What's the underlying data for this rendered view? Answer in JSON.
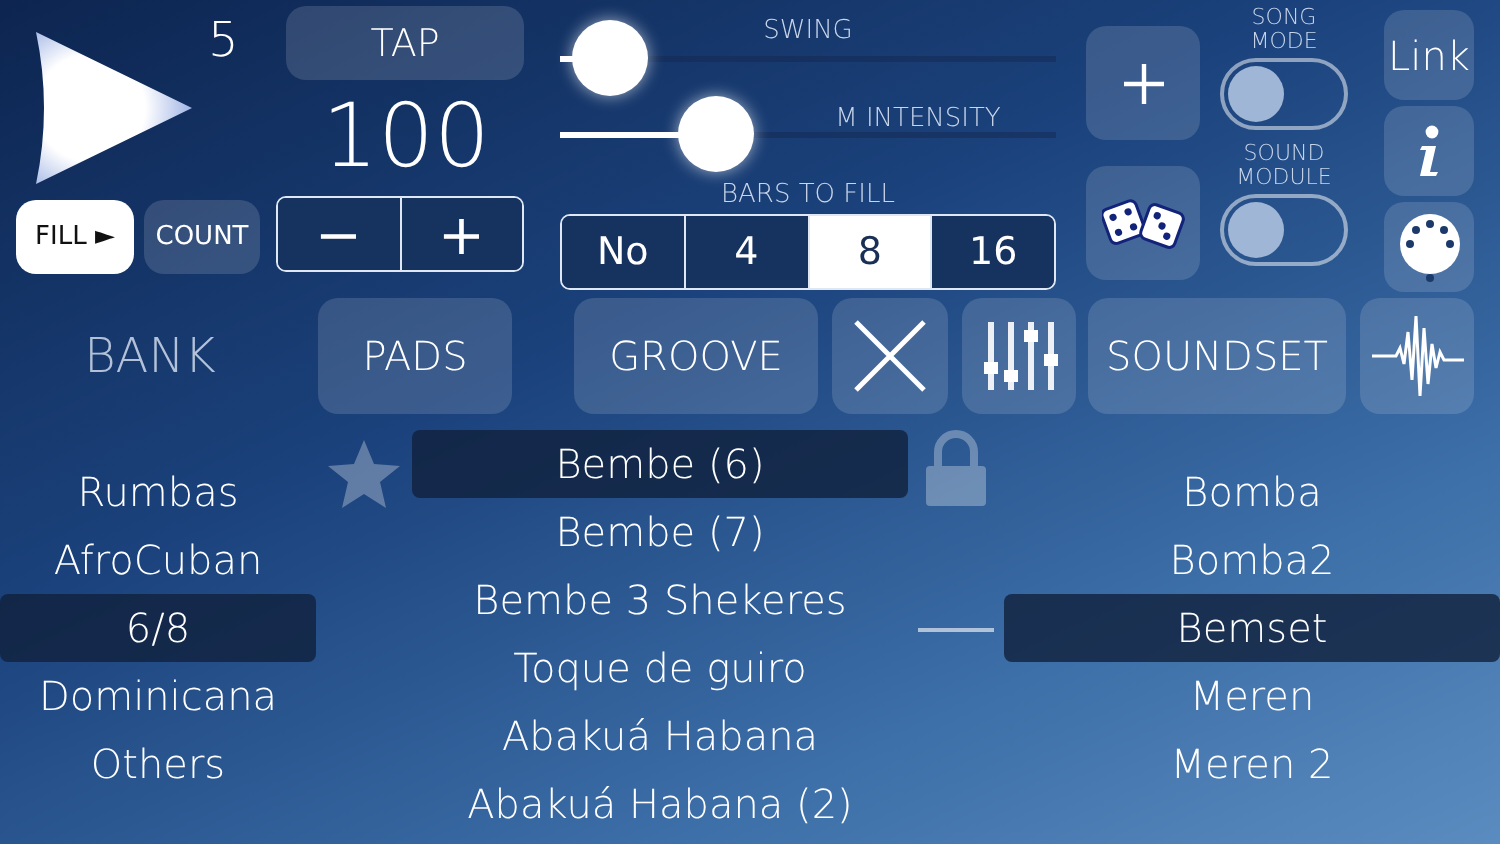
{
  "transport": {
    "bar_count": "5",
    "tap": "TAP",
    "tempo": "100",
    "decrease": "−",
    "increase": "+"
  },
  "fill_buttons": [
    {
      "label": "FILL ►",
      "on": true
    },
    {
      "label": "COUNT",
      "on": false
    }
  ],
  "sliders": [
    {
      "label": "SWING",
      "level": 0.03
    },
    {
      "label": "M INTENSITY",
      "level": 0.28
    }
  ],
  "bars_to_fill": {
    "label": "BARS TO FILL",
    "options": [
      {
        "label": "No",
        "selected": false
      },
      {
        "label": "4",
        "selected": false
      },
      {
        "label": "8",
        "selected": true
      },
      {
        "label": "16",
        "selected": false
      }
    ]
  },
  "toggles": [
    {
      "label": "SONG\nMODE",
      "on": false
    },
    {
      "label": "SOUND\nMODULE",
      "on": false
    }
  ],
  "link": "Link",
  "nav": [
    {
      "kind": "text",
      "label": "BANK",
      "selected": false
    },
    {
      "kind": "button",
      "label": "PADS",
      "selected": false
    },
    {
      "kind": "button",
      "label": "GROOVE",
      "selected": false
    },
    {
      "kind": "close",
      "selected": false
    },
    {
      "kind": "mixer",
      "selected": false
    },
    {
      "kind": "button",
      "label": "SOUNDSET",
      "selected": false
    },
    {
      "kind": "wave",
      "selected": false
    }
  ],
  "banks": [
    {
      "label": "Rumbas",
      "selected": false
    },
    {
      "label": "AfroCuban",
      "selected": false
    },
    {
      "label": "6/8",
      "selected": true
    },
    {
      "label": "Dominicana",
      "selected": false
    },
    {
      "label": "Others",
      "selected": false
    }
  ],
  "grooves": [
    {
      "label": "Bembe (6)",
      "selected": true
    },
    {
      "label": "Bembe (7)",
      "selected": false
    },
    {
      "label": "Bembe 3 Shekeres",
      "selected": false
    },
    {
      "label": "Toque de guiro",
      "selected": false
    },
    {
      "label": "Abakuá Habana",
      "selected": false
    },
    {
      "label": "Abakuá Habana (2)",
      "selected": false
    }
  ],
  "favorite": false,
  "locked": true,
  "soundsets": [
    {
      "label": "Bomba",
      "selected": false
    },
    {
      "label": "Bomba2",
      "selected": false
    },
    {
      "label": "Bemset",
      "selected": true
    },
    {
      "label": "Meren",
      "selected": false
    },
    {
      "label": "Meren 2",
      "selected": false
    }
  ]
}
